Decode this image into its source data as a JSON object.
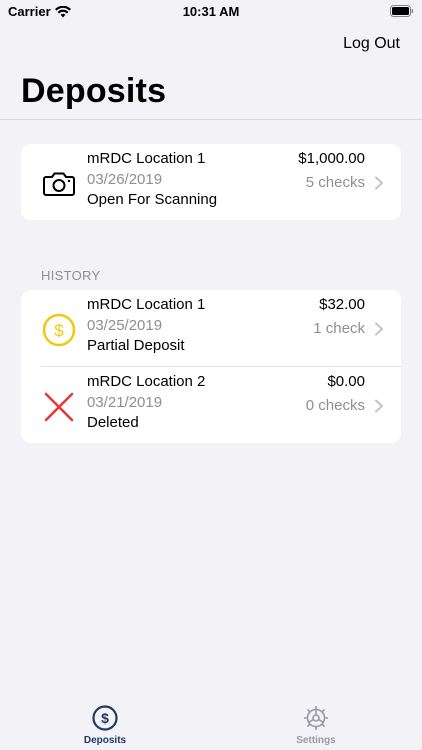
{
  "status_bar": {
    "carrier": "Carrier",
    "time": "10:31 AM"
  },
  "nav": {
    "logout_label": "Log Out",
    "title": "Deposits"
  },
  "current_deposit": {
    "location": "mRDC Location 1",
    "date": "03/26/2019",
    "status": "Open For Scanning",
    "amount": "$1,000.00",
    "checks": "5 checks",
    "icon": "camera-icon"
  },
  "history": {
    "header": "HISTORY",
    "items": [
      {
        "location": "mRDC Location 1",
        "date": "03/25/2019",
        "status": "Partial Deposit",
        "amount": "$32.00",
        "checks": "1 check",
        "icon": "dollar-coin-icon",
        "icon_color": "#f2c80f"
      },
      {
        "location": "mRDC Location 2",
        "date": "03/21/2019",
        "status": "Deleted",
        "amount": "$0.00",
        "checks": "0 checks",
        "icon": "deleted-x-icon",
        "icon_color": "#e53935"
      }
    ]
  },
  "tabs": [
    {
      "label": "Deposits",
      "icon": "dollar-circle-icon",
      "active": true,
      "color": "#1f3a63"
    },
    {
      "label": "Settings",
      "icon": "gear-icon",
      "active": false,
      "color": "#9a9aa0"
    }
  ]
}
